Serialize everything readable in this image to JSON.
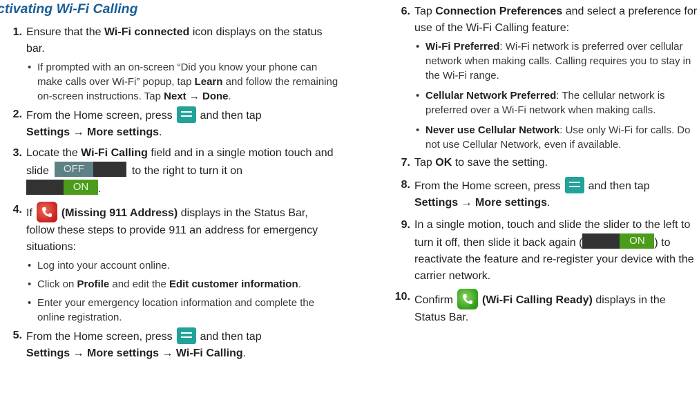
{
  "heading": "ctivating Wi-Fi Calling",
  "left_steps": {
    "s1": {
      "num": "1.",
      "t1": "Ensure that the ",
      "b1": "Wi-Fi connected",
      "t2": " icon displays on the status bar.",
      "bullet": {
        "t1": "If prompted with an on-screen “Did you know your phone can make calls over Wi-Fi” popup, tap ",
        "b1": "Learn",
        "t2": " and follow the remaining on-screen instructions. Tap ",
        "b2": "Next → Done",
        "t3": "."
      }
    },
    "s2": {
      "num": "2.",
      "t1": "From the Home screen, press",
      "t2": "and then tap",
      "b1": "Settings → More settings",
      "t3": "."
    },
    "s3": {
      "num": "3.",
      "t1": "Locate the ",
      "b1": "Wi-Fi Calling",
      "t2": " field and in a single motion touch and slide",
      "toggle_off": "OFF",
      "t3": "to the right to turn it on",
      "toggle_on": "ON",
      "t4": "."
    },
    "s4": {
      "num": "4.",
      "t1": "If",
      "b1": "(Missing 911 Address)",
      "t2": " displays in the Status Bar, follow these steps to provide 911 an address for emergency situations:",
      "bullets": [
        {
          "t1": "Log into your account online."
        },
        {
          "t1": "Click on ",
          "b1": "Profile",
          "t2": " and edit the ",
          "b2": "Edit customer information",
          "t3": "."
        },
        {
          "t1": "Enter your emergency location information and complete the online registration."
        }
      ]
    },
    "s5": {
      "num": "5.",
      "t1": "From the Home screen, press",
      "t2": "and then tap",
      "b1": "Settings → More settings → Wi-Fi Calling",
      "t3": "."
    }
  },
  "right_steps": {
    "s6": {
      "num": "6.",
      "t1": "Tap ",
      "b1": "Connection Preferences",
      "t2": " and select a preference for use of the Wi-Fi Calling feature:",
      "bullets": [
        {
          "b1": "Wi-Fi Preferred",
          "t1": ": Wi-Fi network is preferred over cellular network when making calls. Calling requires you to stay in the Wi-Fi range."
        },
        {
          "b1": "Cellular Network Preferred",
          "t1": ": The cellular network is preferred over a Wi-Fi network when making calls."
        },
        {
          "b1": "Never use Cellular Network",
          "t1": ": Use only Wi-Fi for calls. Do not use Cellular Network, even if available."
        }
      ]
    },
    "s7": {
      "num": "7.",
      "t1": "Tap ",
      "b1": "OK",
      "t2": " to save the setting."
    },
    "s8": {
      "num": "8.",
      "t1": "From the Home screen, press",
      "t2": "and then tap",
      "b1": "Settings → More settings",
      "t3": "."
    },
    "s9": {
      "num": "9.",
      "t1": "In a single motion, touch and slide the slider to the left to turn it off, then slide it back again (",
      "toggle_on": "ON",
      "t2": ") to reactivate the feature and re-register your device with the carrier network."
    },
    "s10": {
      "num": "10.",
      "t1": "Confirm",
      "b1": "(Wi-Fi Calling Ready)",
      "t2": " displays in the Status Bar."
    }
  },
  "icons": {
    "menu": "menu-key-icon",
    "missing_911": "missing-911-address-icon",
    "wifi_ready": "wifi-calling-ready-icon"
  },
  "colors": {
    "heading": "#1b5e97",
    "menu_icon": "#21a29a",
    "toggle_on": "#4a9c1a",
    "toggle_off": "#5d8185"
  }
}
